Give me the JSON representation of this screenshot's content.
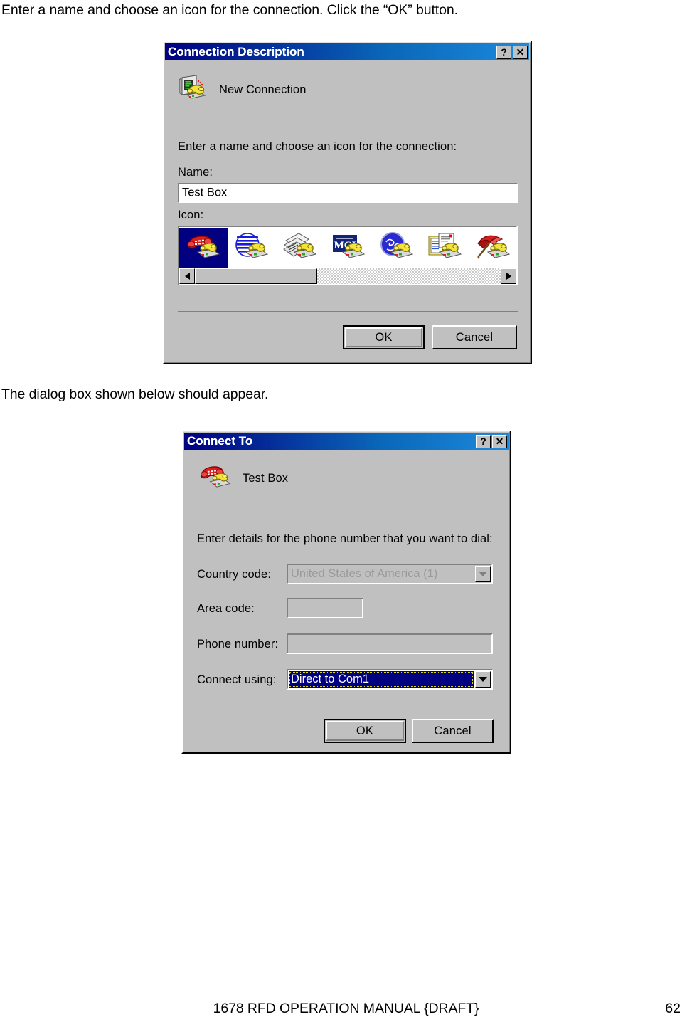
{
  "document": {
    "instruction_1": "Enter a name and choose an icon for the connection.  Click the “OK” button.",
    "instruction_2": "The dialog box shown below should appear.",
    "footer_title": "1678 RFD OPERATION MANUAL {DRAFT}",
    "footer_page_number": "62"
  },
  "dialog_connection_description": {
    "titlebar": {
      "title": "Connection Description",
      "help_button": "?",
      "close_button": "✕"
    },
    "header_label": "New Connection",
    "header_icon": "computer-phone-icon",
    "prompt": "Enter a name and choose an icon for the connection:",
    "name_field": {
      "label": "Name:",
      "label_accel": "N",
      "value": "Test Box"
    },
    "icon_field": {
      "label": "Icon:",
      "label_accel": "I",
      "selected_index": 0,
      "icons": [
        {
          "name": "red-telephone-icon",
          "selected": true
        },
        {
          "name": "blue-striped-globe-icon",
          "selected": false
        },
        {
          "name": "fax-documents-icon",
          "selected": false
        },
        {
          "name": "mci-logo-icon",
          "selected": false
        },
        {
          "name": "ge-logo-globe-icon",
          "selected": false
        },
        {
          "name": "documents-stack-icon",
          "selected": false
        },
        {
          "name": "red-umbrella-icon",
          "selected": false
        }
      ],
      "scrollbar": {
        "left_arrow": "scroll-left-arrow-icon",
        "right_arrow": "scroll-right-arrow-icon",
        "thumb_position_pct": 0,
        "thumb_width_pct": 40
      }
    },
    "buttons": {
      "ok": "OK",
      "cancel": "Cancel",
      "default": "ok"
    }
  },
  "dialog_connect_to": {
    "titlebar": {
      "title": "Connect To",
      "help_button": "?",
      "close_button": "✕"
    },
    "header_label": "Test Box",
    "header_icon": "red-telephone-icon",
    "prompt": "Enter details for the phone number that you want to dial:",
    "fields": [
      {
        "label": "Country code:",
        "label_accel": "C",
        "type": "combobox",
        "value": "United States of America (1)",
        "disabled": true,
        "focused": false
      },
      {
        "label": "Area code:",
        "label_accel": "e",
        "type": "textbox",
        "value": "",
        "disabled": false,
        "focused": false
      },
      {
        "label": "Phone number:",
        "label_accel": "P",
        "type": "textbox",
        "value": "",
        "disabled": false,
        "focused": false
      },
      {
        "label": "Connect using:",
        "label_accel": "n",
        "type": "combobox",
        "value": "Direct to Com1",
        "disabled": false,
        "focused": true
      }
    ],
    "buttons": {
      "ok": "OK",
      "cancel": "Cancel",
      "default": "ok"
    }
  },
  "colors": {
    "titlebar_gradient_start": "#000080",
    "titlebar_gradient_end": "#1c8adc",
    "dialog_face": "#c0c0c0",
    "selection_blue": "#000080",
    "selection_text": "#ffffff",
    "disabled_text": "#9a9a9a"
  }
}
